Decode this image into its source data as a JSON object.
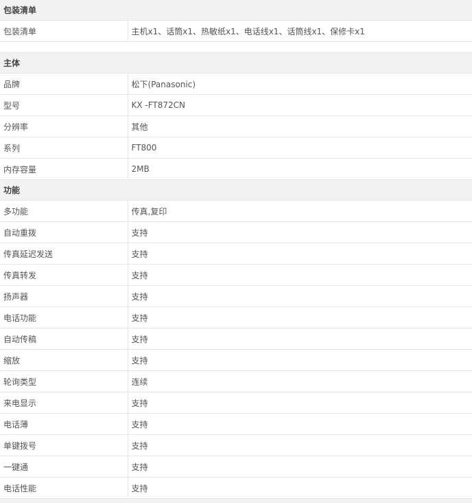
{
  "sections": [
    {
      "title": "包装清单",
      "rows": [
        {
          "key": "包装清单",
          "value": "主机x1、话筒x1、热敏纸x1、电话线x1、话筒线x1、保修卡x1"
        }
      ]
    },
    {
      "title": "主体",
      "rows": [
        {
          "key": "品牌",
          "value": "松下(Panasonic)"
        },
        {
          "key": "型号",
          "value": "KX -FT872CN"
        },
        {
          "key": "分辨率",
          "value": "其他"
        },
        {
          "key": "系列",
          "value": "FT800"
        },
        {
          "key": "内存容量",
          "value": "2MB"
        }
      ]
    },
    {
      "title": "功能",
      "rows": [
        {
          "key": "多功能",
          "value": "传真,复印"
        },
        {
          "key": "自动重拨",
          "value": "支持"
        },
        {
          "key": "传真延迟发送",
          "value": "支持"
        },
        {
          "key": "传真转发",
          "value": "支持"
        },
        {
          "key": "扬声器",
          "value": "支持"
        },
        {
          "key": "电话功能",
          "value": "支持"
        },
        {
          "key": "自动传稿",
          "value": "支持"
        },
        {
          "key": "缩放",
          "value": "支持"
        },
        {
          "key": "轮询类型",
          "value": "连续"
        },
        {
          "key": "来电显示",
          "value": "支持"
        },
        {
          "key": "电话薄",
          "value": "支持"
        },
        {
          "key": "单键拨号",
          "value": "支持"
        },
        {
          "key": "一键通",
          "value": "支持"
        },
        {
          "key": "电话性能",
          "value": "支持"
        }
      ]
    }
  ]
}
